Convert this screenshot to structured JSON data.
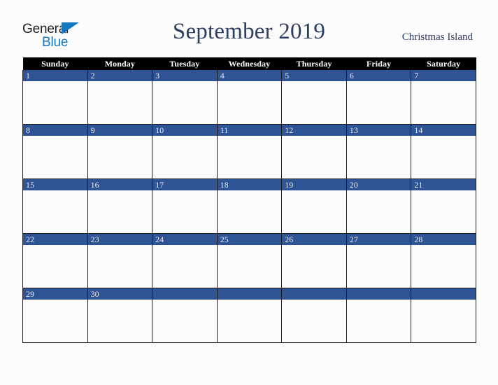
{
  "brand": {
    "name_part1": "General",
    "name_part2": "Blue",
    "triangle_icon": "triangle-icon",
    "color_dark": "#231f20",
    "color_blue": "#1577be"
  },
  "header": {
    "title": "September 2019",
    "location": "Christmas Island",
    "title_color": "#2c3e63"
  },
  "calendar": {
    "weekday_headers": [
      "Sunday",
      "Monday",
      "Tuesday",
      "Wednesday",
      "Thursday",
      "Friday",
      "Saturday"
    ],
    "header_bg": "#000000",
    "date_bar_color": "#2f5496",
    "cell_bg": "#fcfcfc",
    "grid_color": "#1a1a1a",
    "weeks": [
      {
        "days": [
          {
            "date": "1"
          },
          {
            "date": "2"
          },
          {
            "date": "3"
          },
          {
            "date": "4"
          },
          {
            "date": "5"
          },
          {
            "date": "6"
          },
          {
            "date": "7"
          }
        ]
      },
      {
        "days": [
          {
            "date": "8"
          },
          {
            "date": "9"
          },
          {
            "date": "10"
          },
          {
            "date": "11"
          },
          {
            "date": "12"
          },
          {
            "date": "13"
          },
          {
            "date": "14"
          }
        ]
      },
      {
        "days": [
          {
            "date": "15"
          },
          {
            "date": "16"
          },
          {
            "date": "17"
          },
          {
            "date": "18"
          },
          {
            "date": "19"
          },
          {
            "date": "20"
          },
          {
            "date": "21"
          }
        ]
      },
      {
        "days": [
          {
            "date": "22"
          },
          {
            "date": "23"
          },
          {
            "date": "24"
          },
          {
            "date": "25"
          },
          {
            "date": "26"
          },
          {
            "date": "27"
          },
          {
            "date": "28"
          }
        ]
      },
      {
        "days": [
          {
            "date": "29"
          },
          {
            "date": "30"
          },
          {
            "date": ""
          },
          {
            "date": ""
          },
          {
            "date": ""
          },
          {
            "date": ""
          },
          {
            "date": ""
          }
        ]
      }
    ]
  }
}
